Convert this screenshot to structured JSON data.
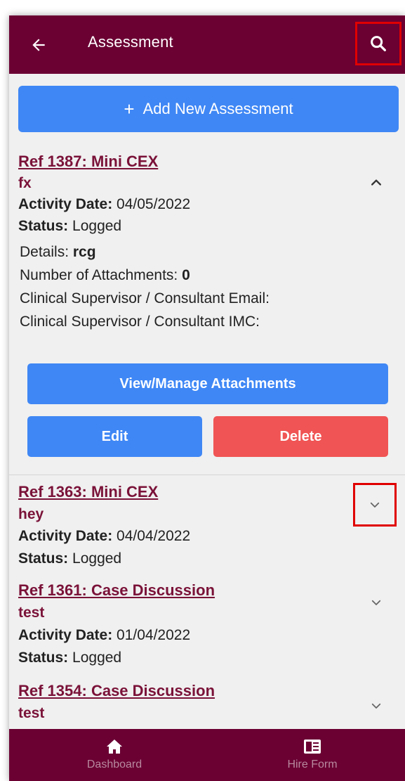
{
  "header": {
    "title": "Assessment",
    "back_icon": "arrow-left-icon",
    "search_icon": "search-icon"
  },
  "add_button": {
    "label": "Add New Assessment",
    "icon": "plus-icon"
  },
  "items": [
    {
      "ref": "Ref 1387: Mini CEX",
      "subtitle": "fx",
      "activity_date_label": "Activity Date:",
      "activity_date": "04/05/2022",
      "status_label": "Status:",
      "status": "Logged",
      "details_label": "Details:",
      "details": "rcg",
      "attachments_label": "Number of Attachments:",
      "attachments": "0",
      "supervisor_email_label": "Clinical Supervisor / Consultant Email:",
      "supervisor_imc_label": "Clinical Supervisor / Consultant IMC:",
      "view_attachments_label": "View/Manage Attachments",
      "edit_label": "Edit",
      "delete_label": "Delete",
      "expanded": true
    },
    {
      "ref": "Ref 1363: Mini CEX",
      "subtitle": "hey",
      "activity_date_label": "Activity Date:",
      "activity_date": "04/04/2022",
      "status_label": "Status:",
      "status": "Logged",
      "expanded": false
    },
    {
      "ref": "Ref 1361: Case Discussion",
      "subtitle": "test",
      "activity_date_label": "Activity Date:",
      "activity_date": "01/04/2022",
      "status_label": "Status:",
      "status": "Logged",
      "expanded": false
    },
    {
      "ref": "Ref 1354: Case Discussion",
      "subtitle": "test",
      "expanded": false
    }
  ],
  "bottom_nav": [
    {
      "label": "Dashboard",
      "icon": "home-icon"
    },
    {
      "label": "Hire Form",
      "icon": "form-icon"
    }
  ],
  "colors": {
    "primary": "#6b0033",
    "accent_blue": "#3f87f5",
    "delete_red": "#f05454",
    "link": "#7a1238",
    "highlight_box": "#e00000"
  }
}
